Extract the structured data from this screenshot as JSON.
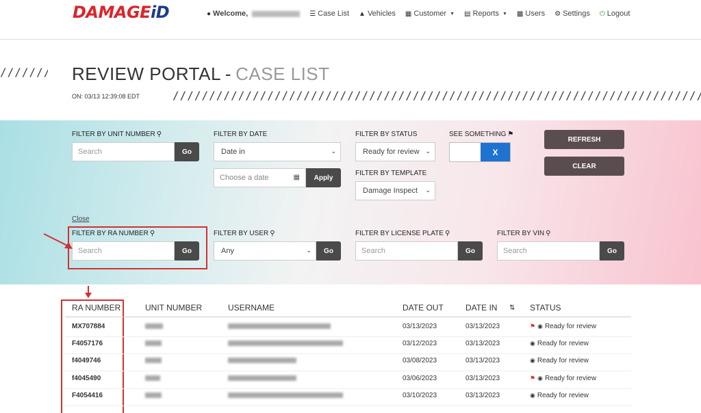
{
  "logo": {
    "part1": "DAMAGE",
    "part2": "iD"
  },
  "nav": {
    "welcome_label": "Welcome,",
    "items": [
      {
        "label": "Case List",
        "icon": "list-icon"
      },
      {
        "label": "Vehicles",
        "icon": "road-icon"
      },
      {
        "label": "Customer",
        "icon": "building-icon"
      },
      {
        "label": "Reports",
        "icon": "reports-icon"
      },
      {
        "label": "Users",
        "icon": "users-icon"
      },
      {
        "label": "Settings",
        "icon": "gear-icon"
      },
      {
        "label": "Logout",
        "icon": "power-icon"
      }
    ]
  },
  "header": {
    "hatch_left": "///////",
    "hatch_right": "/////////////////////////////////////////////////////////////////////////////////////",
    "title_main": "REVIEW PORTAL",
    "title_sep": "-",
    "title_sub": "CASE LIST",
    "timestamp": "ON: 03/13 12:39:08 EDT"
  },
  "filters": {
    "unit_number": {
      "label": "FILTER BY UNIT NUMBER",
      "placeholder": "Search",
      "go": "Go"
    },
    "date": {
      "label": "FILTER BY DATE",
      "selected": "Date in",
      "date_placeholder": "Choose a date",
      "apply": "Apply"
    },
    "status": {
      "label": "FILTER BY STATUS",
      "selected": "Ready for review"
    },
    "template": {
      "label": "FILTER BY TEMPLATE",
      "selected": "Damage Inspect"
    },
    "see_something": {
      "label": "SEE SOMETHING",
      "toggle_x": "X"
    },
    "refresh": "REFRESH",
    "clear": "CLEAR",
    "close": "Close",
    "ra_number": {
      "label": "FILTER BY RA NUMBER",
      "placeholder": "Search",
      "go": "Go"
    },
    "user": {
      "label": "FILTER BY USER",
      "selected": "Any",
      "go": "Go"
    },
    "license_plate": {
      "label": "FILTER BY LICENSE PLATE",
      "placeholder": "Search",
      "go": "Go"
    },
    "vin": {
      "label": "FILTER BY VIN",
      "placeholder": "Search",
      "go": "Go"
    }
  },
  "table": {
    "columns": [
      "RA NUMBER",
      "UNIT NUMBER",
      "USERNAME",
      "DATE OUT",
      "DATE IN",
      "STATUS"
    ],
    "sort_icon": "sort-icon",
    "rows": [
      {
        "ra": "MX707884",
        "date_out": "03/13/2023",
        "date_in": "03/13/2023",
        "status": "Ready for review",
        "flag": true
      },
      {
        "ra": "F4057176",
        "date_out": "03/12/2023",
        "date_in": "03/13/2023",
        "status": "Ready for review",
        "flag": false
      },
      {
        "ra": "f4049746",
        "date_out": "03/08/2023",
        "date_in": "03/13/2023",
        "status": "Ready for review",
        "flag": false
      },
      {
        "ra": "f4045490",
        "date_out": "03/06/2023",
        "date_in": "03/13/2023",
        "status": "Ready for review",
        "flag": true
      },
      {
        "ra": "F4054416",
        "date_out": "03/10/2023",
        "date_in": "03/13/2023",
        "status": "Ready for review",
        "flag": false
      }
    ]
  },
  "colors": {
    "brand_red": "#d9262b",
    "brand_blue": "#1e3c8c",
    "annotation_red": "#d23030",
    "toggle_blue": "#1e73d1",
    "button_dark": "#5a4d50"
  }
}
